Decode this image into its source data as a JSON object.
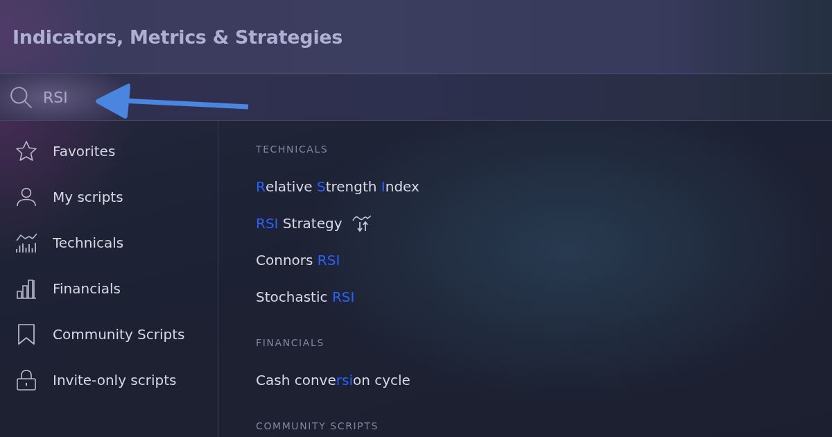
{
  "title": "Indicators, Metrics & Strategies",
  "search": {
    "value": "RSI"
  },
  "sidebar": {
    "items": [
      {
        "label": "Favorites"
      },
      {
        "label": "My scripts"
      },
      {
        "label": "Technicals"
      },
      {
        "label": "Financials"
      },
      {
        "label": "Community Scripts"
      },
      {
        "label": "Invite-only scripts"
      }
    ]
  },
  "results": [
    {
      "heading": "TECHNICALS",
      "items": [
        {
          "kind": "indicator",
          "parts": [
            {
              "text": "R",
              "match": true
            },
            {
              "text": "elative ",
              "match": false
            },
            {
              "text": "S",
              "match": true
            },
            {
              "text": "trength ",
              "match": false
            },
            {
              "text": "I",
              "match": true
            },
            {
              "text": "ndex",
              "match": false
            }
          ]
        },
        {
          "kind": "strategy",
          "parts": [
            {
              "text": "RSI",
              "match": true
            },
            {
              "text": " Strategy",
              "match": false
            }
          ]
        },
        {
          "kind": "indicator",
          "parts": [
            {
              "text": "Connors ",
              "match": false
            },
            {
              "text": "RSI",
              "match": true
            }
          ]
        },
        {
          "kind": "indicator",
          "parts": [
            {
              "text": "Stochastic ",
              "match": false
            },
            {
              "text": "RSI",
              "match": true
            }
          ]
        }
      ]
    },
    {
      "heading": "FINANCIALS",
      "items": [
        {
          "kind": "indicator",
          "parts": [
            {
              "text": "Cash conve",
              "match": false
            },
            {
              "text": "rsi",
              "match": true
            },
            {
              "text": "on cycle",
              "match": false
            }
          ]
        }
      ]
    },
    {
      "heading": "COMMUNITY SCRIPTS"
    }
  ]
}
